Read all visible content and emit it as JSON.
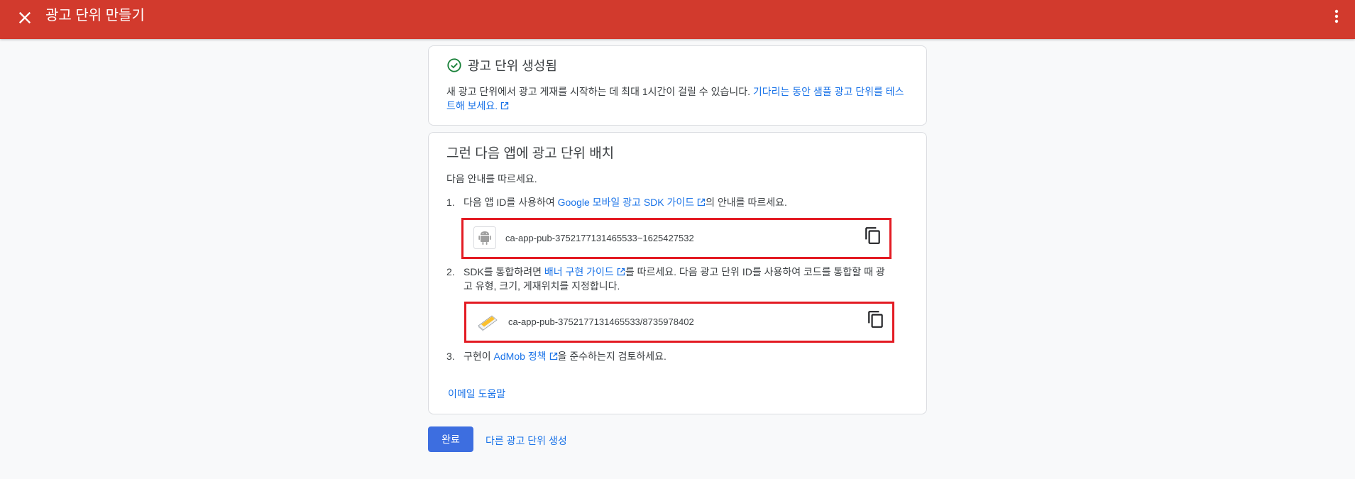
{
  "header": {
    "title": "광고 단위 만들기",
    "close_icon": "close-icon",
    "more_icon": "more-vert-icon",
    "color": "#d23a2d"
  },
  "success_card": {
    "title": "광고 단위 생성됨",
    "body_text": "새 광고 단위에서 광고 게재를 시작하는 데 최대 1시간이 걸릴 수 있습니다. ",
    "body_link": "기다리는 동안 샘플 광고 단위를 테스트해 보세요."
  },
  "placement_card": {
    "heading": "그런 다음 앱에 광고 단위 배치",
    "intro": "다음 안내를 따르세요.",
    "step1": {
      "num": "1.",
      "before": "다음 앱 ID를 사용하여 ",
      "link": "Google 모바일 광고 SDK 가이드",
      "after": "의 안내를 따르세요."
    },
    "app_id": "ca-app-pub-3752177131465533~1625427532",
    "step2": {
      "num": "2.",
      "before": "SDK를 통합하려면 ",
      "link": "배너 구현 가이드",
      "after": "를 따르세요. 다음 광고 단위 ID를 사용하여 코드를 통합할 때 광고 유형, 크기, 게재위치를 지정합니다."
    },
    "ad_unit_id": "ca-app-pub-3752177131465533/8735978402",
    "step3": {
      "num": "3.",
      "before": "구현이 ",
      "link": "AdMob 정책",
      "after": "을 준수하는지 검토하세요."
    },
    "email_help": "이메일 도움말"
  },
  "footer": {
    "done_label": "완료",
    "another_label": "다른 광고 단위 생성"
  }
}
